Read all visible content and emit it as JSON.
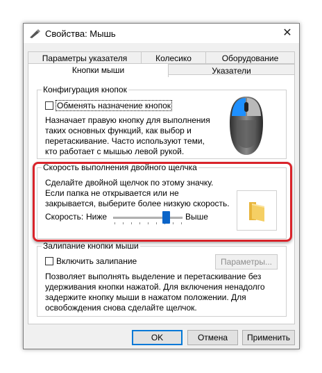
{
  "window": {
    "title": "Свойства: Мышь",
    "title_icon": "mouse-pen-icon",
    "close_glyph": "✕"
  },
  "tabs": {
    "row1": [
      "Параметры указателя",
      "Колесико",
      "Оборудование"
    ],
    "row2": [
      "Кнопки мыши",
      "Указатели"
    ],
    "active": "Кнопки мыши"
  },
  "button_config": {
    "group_label": "Конфигурация кнопок",
    "swap_label": "Обменять назначение кнопок",
    "swap_checked": false,
    "description": [
      "Назначает правую кнопку для выполнения",
      "таких основных функций, как выбор и",
      "перетаскивание. Часто используют теми,",
      "кто работает с мышью левой рукой."
    ]
  },
  "double_click": {
    "group_label": "Скорость выполнения двойного щелчка",
    "description": [
      "Сделайте двойной щелчок по этому значку.",
      "Если папка не открывается или не",
      "закрывается, выберите более низкую скорость."
    ],
    "speed_label": "Скорость:",
    "low_label": "Ниже",
    "high_label": "Выше",
    "speed_fraction": 0.8,
    "test_icon": "folder-icon"
  },
  "click_lock": {
    "group_label": "Залипание кнопки мыши",
    "enable_label": "Включить залипание",
    "enable_checked": false,
    "settings_button": "Параметры...",
    "description": [
      "Позволяет выполнять выделение и перетаскивание без",
      "удерживания кнопки нажатой. Для включения ненадолго",
      "задержите кнопку мыши в нажатом положении. Для",
      "освобождения снова сделайте щелчок."
    ]
  },
  "footer": {
    "ok": "OK",
    "cancel": "Отмена",
    "apply": "Применить"
  },
  "colors": {
    "accent": "#0078d7",
    "highlight": "#d9232a",
    "mouse_button": "#1e90ff"
  }
}
